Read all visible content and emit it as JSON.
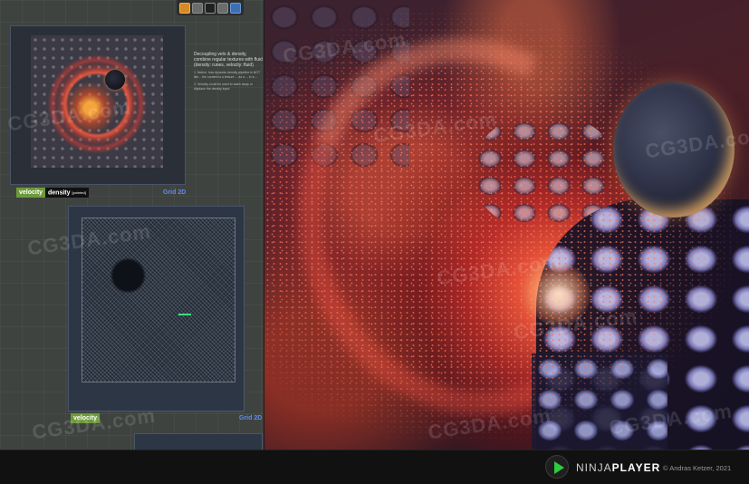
{
  "editor": {
    "node1": {
      "velocity_tag": "velocity",
      "density_tag": "density",
      "density_sub": "[pointed]",
      "grid_tag": "Grid 2D"
    },
    "notes": {
      "title": "Decoupling velo & density, combine regular textures with fluid (density: runes, velocity: fluid)",
      "item1": "1. Notice, how dynamic density pipeline is NOT like... the content is a texture ... as a ... in a ... ",
      "item2": "2. Velocity could be used to wash away or displace the density input."
    },
    "node2": {
      "velocity_tag": "velocity",
      "grid_tag": "Grid 2D"
    }
  },
  "watermark_text": "CG3DA.com",
  "player": {
    "brand_ninja": "NINJA",
    "brand_player": "PLAYER",
    "copyright": "© Andras Ketzer, 2021",
    "accent_color": "#2ecc40",
    "play_icon": "play-icon"
  }
}
